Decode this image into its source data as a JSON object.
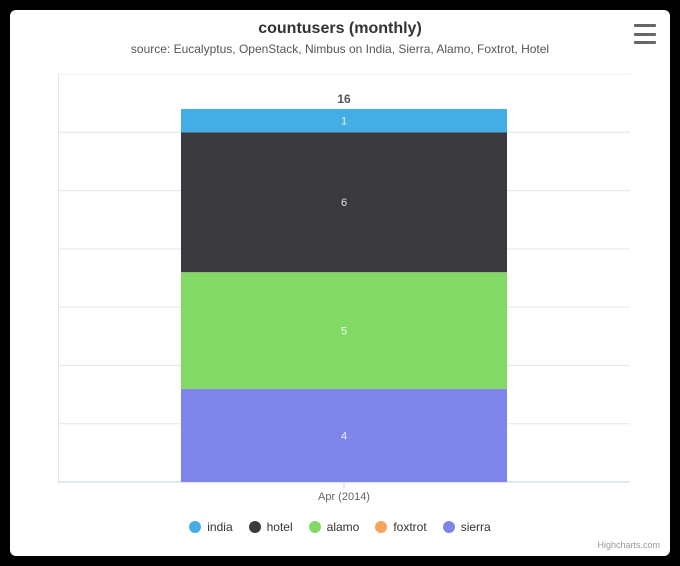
{
  "title": "countusers (monthly)",
  "subtitle": "source: Eucalyptus, OpenStack, Nimbus on India, Sierra, Alamo, Foxtrot, Hotel",
  "credit": "Highcharts.com",
  "y_ticks": [
    "0",
    "2.5",
    "5",
    "7.5",
    "10",
    "12.5",
    "15",
    "17.5"
  ],
  "x_category": "Apr (2014)",
  "total_label": "16",
  "chart_data": {
    "type": "bar",
    "stacked": true,
    "categories": [
      "Apr (2014)"
    ],
    "series": [
      {
        "name": "india",
        "color": "#44aee4",
        "values": [
          1
        ]
      },
      {
        "name": "hotel",
        "color": "#3b3b3f",
        "values": [
          6
        ]
      },
      {
        "name": "alamo",
        "color": "#82d965",
        "values": [
          5
        ]
      },
      {
        "name": "foxtrot",
        "color": "#f7a35c",
        "values": [
          0
        ]
      },
      {
        "name": "sierra",
        "color": "#8085e9",
        "values": [
          4
        ]
      }
    ],
    "ylim": [
      0,
      17.5
    ],
    "xlabel": "",
    "ylabel": "",
    "title": "countusers (monthly)"
  },
  "legend": [
    {
      "label": "india",
      "color": "#44aee4"
    },
    {
      "label": "hotel",
      "color": "#3b3b3f"
    },
    {
      "label": "alamo",
      "color": "#82d965"
    },
    {
      "label": "foxtrot",
      "color": "#f7a35c"
    },
    {
      "label": "sierra",
      "color": "#8085e9"
    }
  ]
}
